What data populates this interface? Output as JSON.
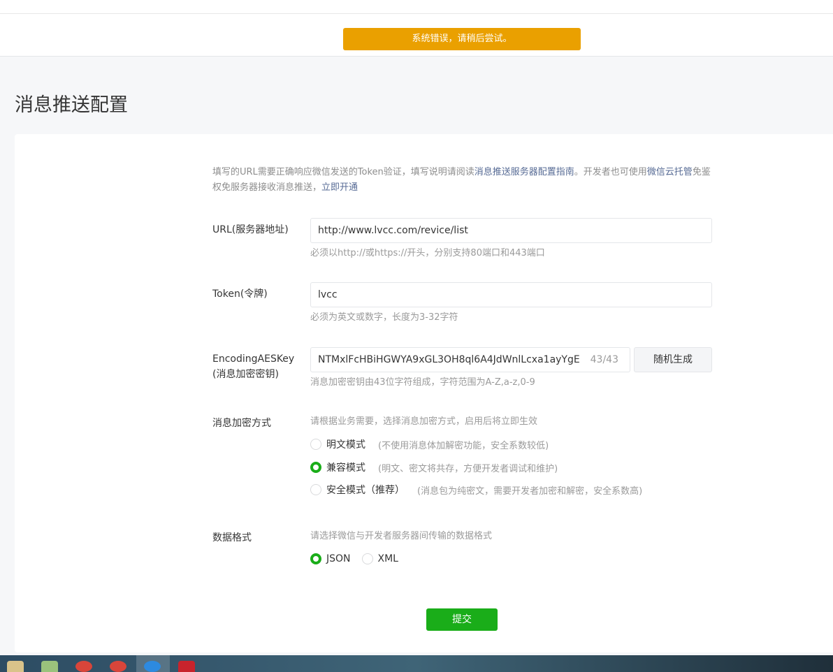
{
  "toast": {
    "text": "系统错误，请稍后尝试。"
  },
  "page": {
    "title": "消息推送配置"
  },
  "notice": {
    "text1": "填写的URL需要正确响应微信发送的Token验证，填写说明请阅读",
    "link1": "消息推送服务器配置指南",
    "text2": "。开发者也可使用",
    "link2": "微信云托管",
    "text3": "免鉴权免服务器接收消息推送，",
    "link3": "立即开通"
  },
  "url": {
    "label": "URL(服务器地址)",
    "value": "http://www.lvcc.com/revice/list",
    "hint": "必须以http://或https://开头，分别支持80端口和443端口"
  },
  "token": {
    "label": "Token(令牌)",
    "value": "lvcc",
    "hint": "必须为英文或数字，长度为3-32字符"
  },
  "aes": {
    "label_line1": "EncodingAESKey",
    "label_line2": "(消息加密密钥)",
    "value": "NTMxlFcHBiHGWYA9xGL3OH8ql6A4JdWnlLcxa1ayYgE",
    "count": "43/43",
    "generate_button": "随机生成",
    "hint": "消息加密密钥由43位字符组成，字符范围为A-Z,a-z,0-9"
  },
  "encryption": {
    "label": "消息加密方式",
    "hint": "请根据业务需要，选择消息加密方式，启用后将立即生效",
    "options": [
      {
        "label": "明文模式",
        "desc": "(不使用消息体加解密功能，安全系数较低)",
        "checked": false
      },
      {
        "label": "兼容模式",
        "desc": "(明文、密文将共存，方便开发者调试和维护)",
        "checked": true
      },
      {
        "label": "安全模式（推荐）",
        "desc": "(消息包为纯密文，需要开发者加密和解密，安全系数高)",
        "checked": false
      }
    ]
  },
  "format": {
    "label": "数据格式",
    "hint": "请选择微信与开发者服务器间传输的数据格式",
    "options": [
      {
        "label": "JSON",
        "checked": true
      },
      {
        "label": "XML",
        "checked": false
      }
    ]
  },
  "submit": {
    "label": "提交"
  },
  "colors": {
    "accent": "#1aad19",
    "toast": "#eaa000",
    "link": "#576b95"
  }
}
